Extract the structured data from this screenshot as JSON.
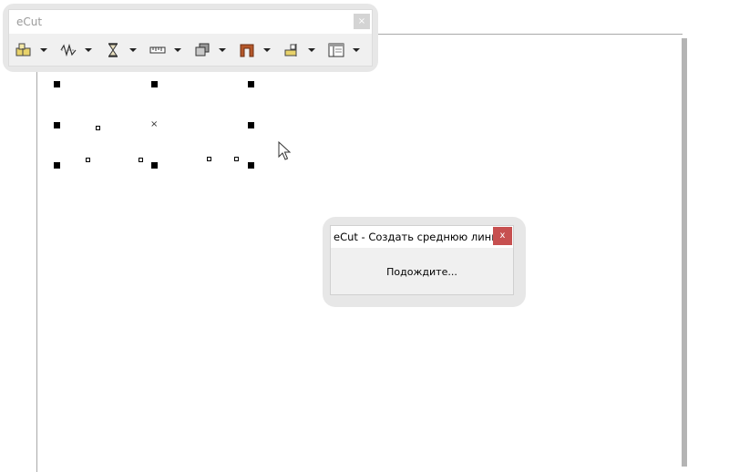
{
  "toolbar": {
    "title": "eCut",
    "close_label": "×",
    "buttons": [
      {
        "icon": "layout-icon"
      },
      {
        "icon": "wave-line-icon"
      },
      {
        "icon": "hourglass-icon"
      },
      {
        "icon": "ruler-icon"
      },
      {
        "icon": "stack-icon"
      },
      {
        "icon": "arch-frame-icon"
      },
      {
        "icon": "align-icon"
      },
      {
        "icon": "panel-icon"
      }
    ]
  },
  "canvas": {
    "center_marker": "×"
  },
  "dialog": {
    "title": "eCut - Создать среднюю линию",
    "close_label": "x",
    "message": "Подождите..."
  },
  "colors": {
    "dialog_close": "#c75050",
    "toolbar_bg": "#f0f0f0",
    "icon_orange": "#b5582a",
    "icon_yellow": "#e8d26a"
  }
}
